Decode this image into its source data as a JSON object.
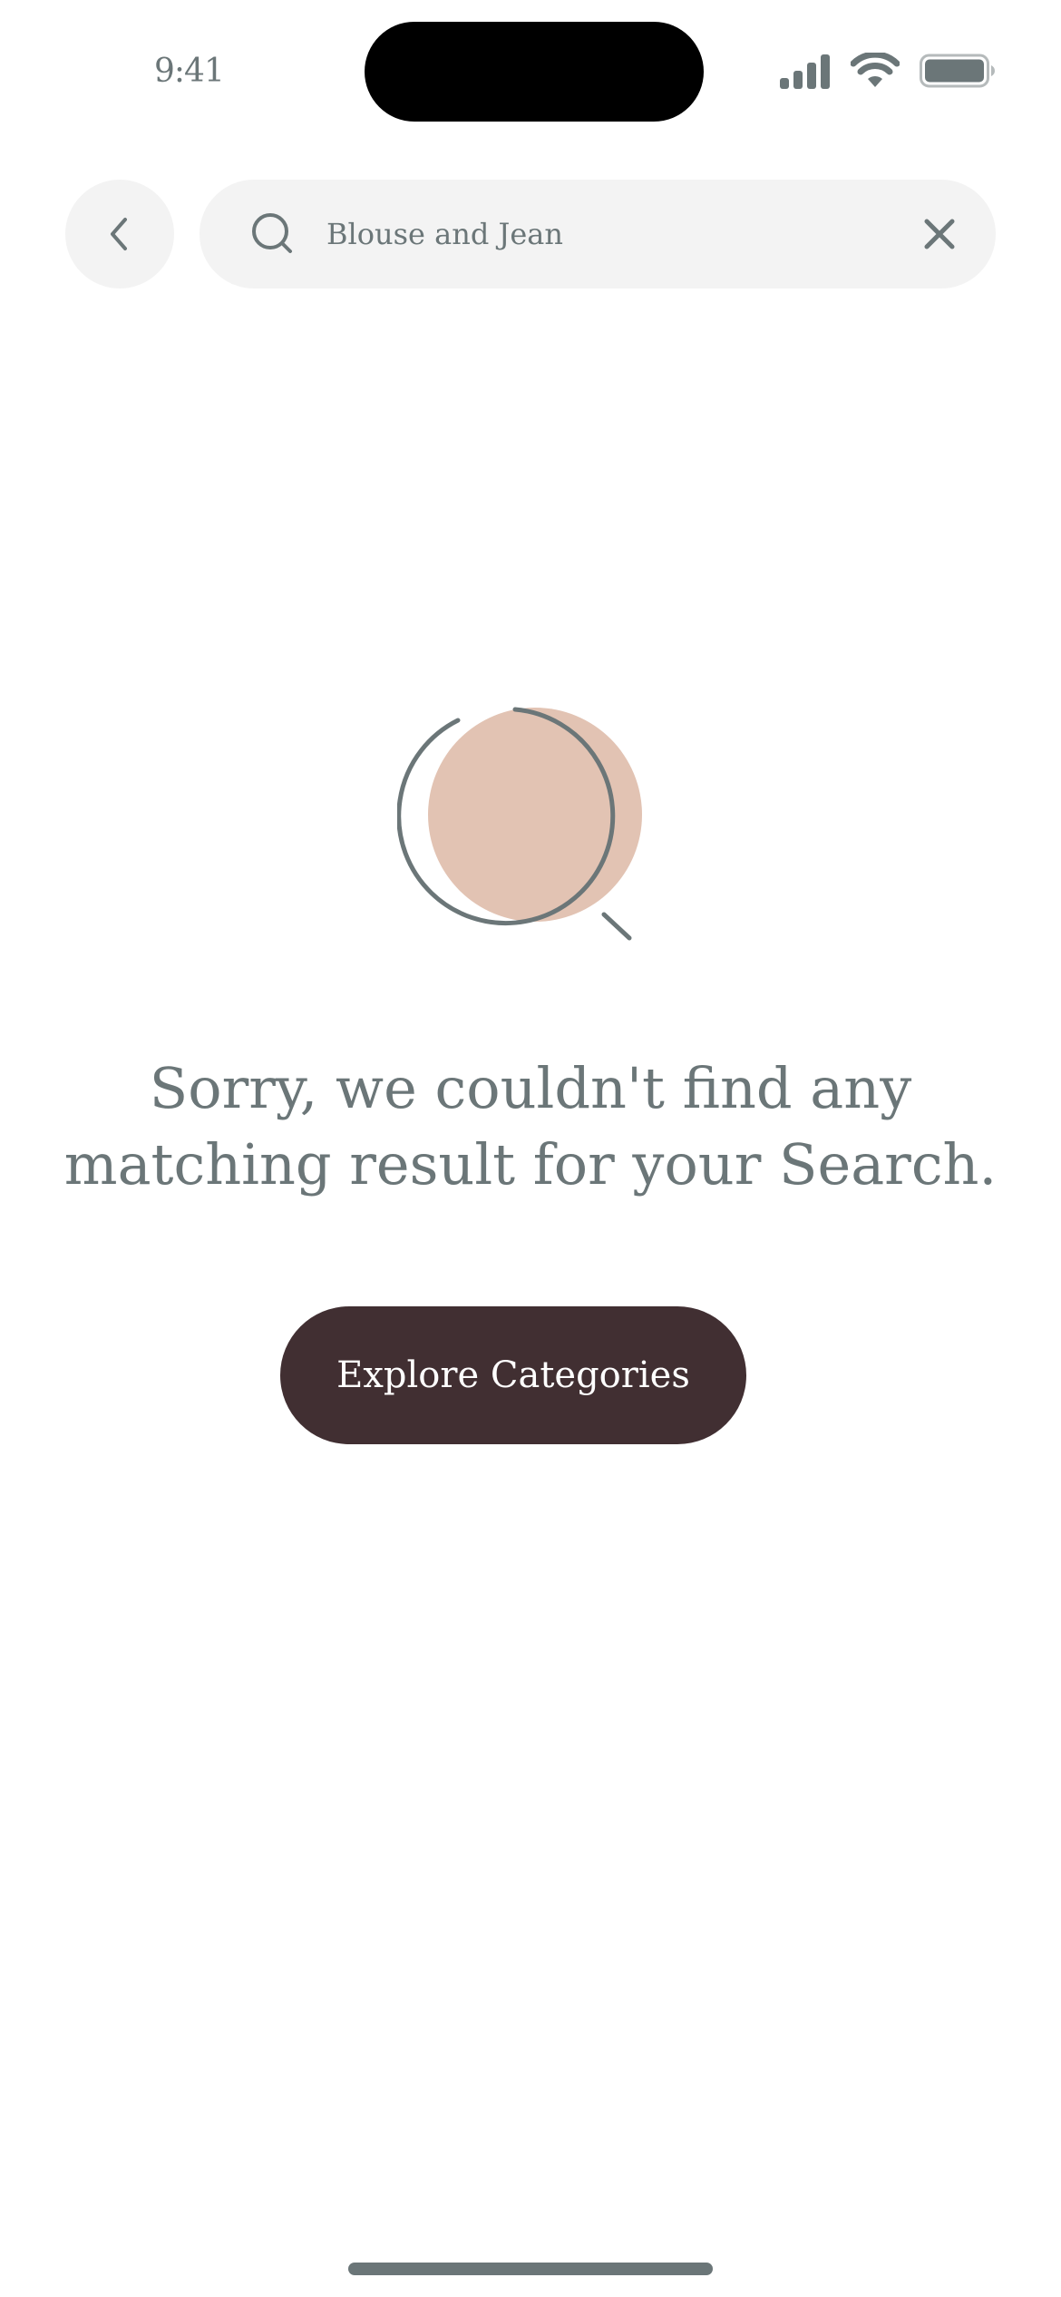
{
  "status_bar": {
    "time": "9:41",
    "icons": [
      "cellular-signal-icon",
      "wifi-icon",
      "battery-icon"
    ]
  },
  "header": {
    "back_icon": "chevron-left-icon",
    "search": {
      "value": "Blouse and Jean",
      "icon": "search-icon",
      "clear_icon": "close-icon"
    }
  },
  "empty_state": {
    "illustration_icon": "magnifier-illustration-icon",
    "message": "Sorry, we couldn't find any matching result for your Search.",
    "button_label": "Explore Categories"
  },
  "colors": {
    "text_gray": "#6b7678",
    "field_bg": "#f3f3f3",
    "accent_peach": "#e2c3b3",
    "button_dark": "#412f32"
  }
}
